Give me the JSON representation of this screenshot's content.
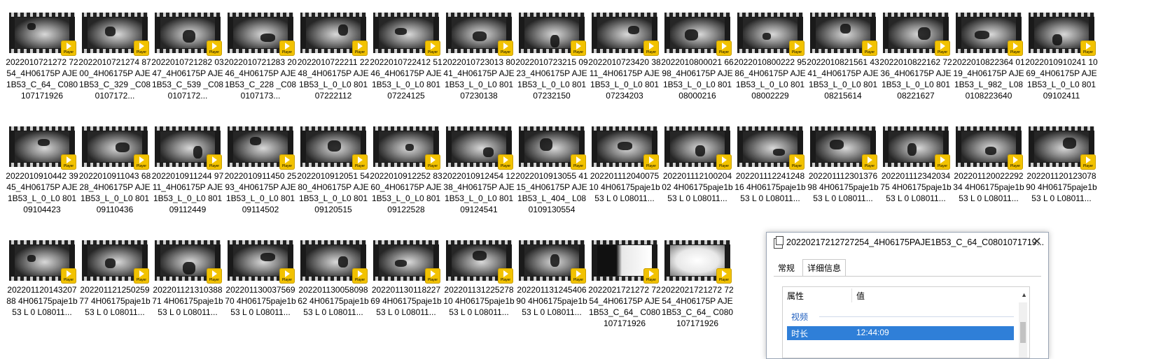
{
  "files": [
    {
      "caption": "2022010721272 7254_4H06175P AJE1B53_C_64_ C080107171926",
      "frame": "dark"
    },
    {
      "caption": "2022010721274 8700_4H06175P AJE1B53_C_329 _C080107172...",
      "frame": "dark"
    },
    {
      "caption": "2022010721282 0347_4H06175P AJE1B53_C_539 _C080107172...",
      "frame": "dark"
    },
    {
      "caption": "2022010721283 2046_4H06175P AJE1B53_C_228 _C080107173...",
      "frame": "dark"
    },
    {
      "caption": "2022010722211 2248_4H06175P AJE1B53_L_0_L0 80107222112",
      "frame": "dark"
    },
    {
      "caption": "2022010722412 5146_4H06175P AJE1B53_L_0_L0 80107224125",
      "frame": "dark"
    },
    {
      "caption": "2022010723013 8041_4H06175P AJE1B53_L_0_L0 80107230138",
      "frame": "dark"
    },
    {
      "caption": "2022010723215 0923_4H06175P AJE1B53_L_0_L0 80107232150",
      "frame": "dark"
    },
    {
      "caption": "2022010723420 3811_4H06175P AJE1B53_L_0_L0 80107234203",
      "frame": "dark"
    },
    {
      "caption": "2022010800021 6698_4H06175P AJE1B53_L_0_L0 80108000216",
      "frame": "dark"
    },
    {
      "caption": "2022010800222 9586_4H06175P AJE1B53_L_0_L0 80108002229",
      "frame": "dark"
    },
    {
      "caption": "2022010821561 4341_4H06175P AJE1B53_L_0_L0 80108215614",
      "frame": "dark"
    },
    {
      "caption": "2022010822162 7236_4H06175P AJE1B53_L_0_L0 80108221627",
      "frame": "dark"
    },
    {
      "caption": "2022010822364 0119_4H06175P AJE1B53_L_982_ L080108223640",
      "frame": "dark"
    },
    {
      "caption": "2022010910241 1069_4H06175P AJE1B53_L_0_L0 80109102411",
      "frame": "dark"
    },
    {
      "caption": "2022010910442 3945_4H06175P AJE1B53_L_0_L0 80109104423",
      "frame": "dark"
    },
    {
      "caption": "2022010911043 6828_4H06175P AJE1B53_L_0_L0 80109110436",
      "frame": "dark"
    },
    {
      "caption": "2022010911244 9711_4H06175P AJE1B53_L_0_L0 80109112449",
      "frame": "dark"
    },
    {
      "caption": "2022010911450 2593_4H06175P AJE1B53_L_0_L0 80109114502",
      "frame": "dark"
    },
    {
      "caption": "2022010912051 5480_4H06175P AJE1B53_L_0_L0 80109120515",
      "frame": "dark"
    },
    {
      "caption": "2022010912252 8360_4H06175P AJE1B53_L_0_L0 80109122528",
      "frame": "dark"
    },
    {
      "caption": "2022010912454 1238_4H06175P AJE1B53_L_0_L0 80109124541",
      "frame": "dark"
    },
    {
      "caption": "2022010913055 4115_4H06175P AJE1B53_L_404_ L080109130554",
      "frame": "dark"
    },
    {
      "caption": "20220111204007510 4H06175paje1b 53 L 0 L08011...",
      "frame": "dark"
    },
    {
      "caption": "20220111210020402 4H06175paje1b 53 L 0 L08011...",
      "frame": "dark"
    },
    {
      "caption": "20220111224124816 4H06175paje1b 53 L 0 L08011...",
      "frame": "dark"
    },
    {
      "caption": "20220111230137698 4H06175paje1b 53 L 0 L08011...",
      "frame": "dark"
    },
    {
      "caption": "20220111234203475 4H06175paje1b 53 L 0 L08011...",
      "frame": "dark"
    },
    {
      "caption": "20220112002229234 4H06175paje1b 53 L 0 L08011...",
      "frame": "dark"
    },
    {
      "caption": "20220112012307890 4H06175paje1b 53 L 0 L08011...",
      "frame": "dark"
    },
    {
      "caption": "20220112014320788 4H06175paje1b 53 L 0 L08011...",
      "frame": "dark"
    },
    {
      "caption": "20220112125025977 4H06175paje1b 53 L 0 L08011...",
      "frame": "dark"
    },
    {
      "caption": "20220112131038871 4H06175paje1b 53 L 0 L08011...",
      "frame": "dark"
    },
    {
      "caption": "20220113003756970 4H06175paje1b 53 L 0 L08011...",
      "frame": "dark"
    },
    {
      "caption": "20220113005809862 4H06175paje1b 53 L 0 L08011...",
      "frame": "dark"
    },
    {
      "caption": "20220113011822769 4H06175paje1b 53 L 0 L08011...",
      "frame": "dark"
    },
    {
      "caption": "20220113122527810 4H06175paje1b 53 L 0 L08011...",
      "frame": "dark"
    },
    {
      "caption": "20220113124540690 4H06175paje1b 53 L 0 L08011...",
      "frame": "dark"
    },
    {
      "caption": "2022021721272 7254_4H06175P AJE1B53_C_64_ C080107171926",
      "frame": "contrast"
    },
    {
      "caption": "2022021721272 7254_4H06175P AJE1B53_C_64_ C080107171926",
      "frame": "bright"
    }
  ],
  "badge_text": "Player",
  "dialog": {
    "title": "20220217212727254_4H06175PAJE1B53_C_64_C0801071719...",
    "close_label": "✕",
    "tabs": [
      {
        "label": "常规",
        "active": false
      },
      {
        "label": "详细信息",
        "active": true
      }
    ],
    "columns": {
      "property": "属性",
      "value": "值"
    },
    "group": "视频",
    "selected_row": {
      "property": "时长",
      "value": "12:44:09"
    }
  }
}
